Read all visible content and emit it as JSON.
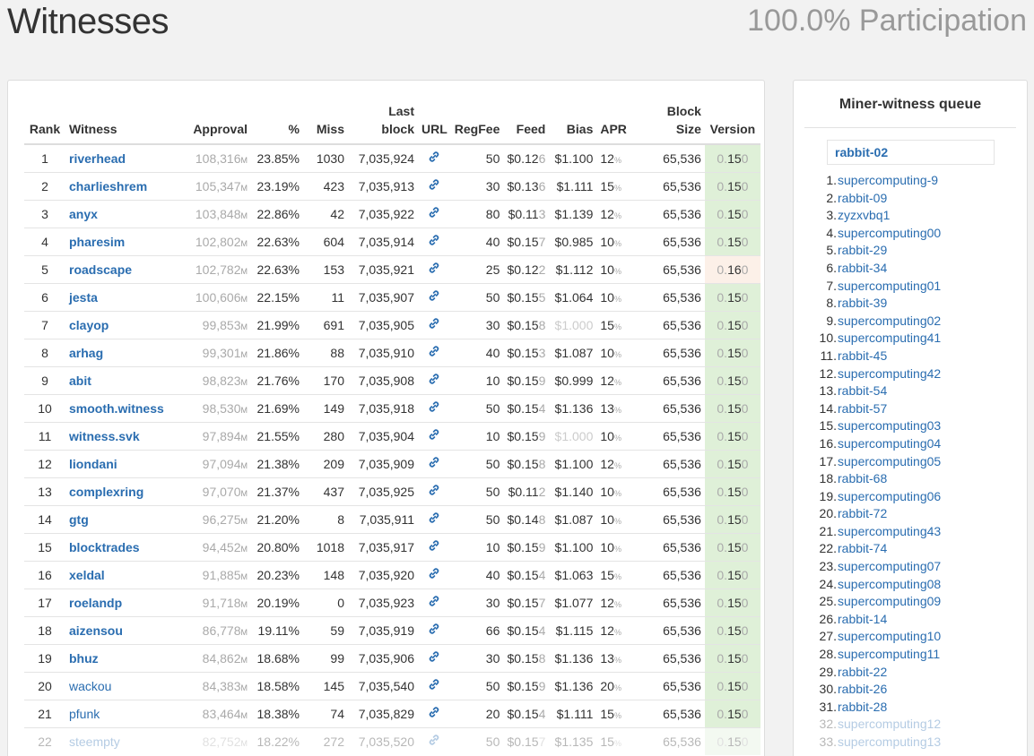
{
  "header": {
    "title": "Witnesses",
    "participation": "100.0% Participation"
  },
  "table": {
    "columns": {
      "rank": "Rank",
      "witness": "Witness",
      "approval": "Approval",
      "pct": "%",
      "miss": "Miss",
      "last1": "Last",
      "last2": "block",
      "url": "URL",
      "regfee": "RegFee",
      "feed": "Feed",
      "bias": "Bias",
      "apr": "APR",
      "size1": "Block",
      "size2": "Size",
      "version": "Version"
    },
    "approval_unit": "M",
    "apr_unit": "%",
    "version_prefix": "0.",
    "version_suffix": "0",
    "colors": {
      "link": "#2a6db0",
      "version_ok": "#dff0d8",
      "version_warn": "#fcf0e8"
    },
    "rows": [
      {
        "rank": "1",
        "name": "riverhead",
        "bold": true,
        "approval": "108,316",
        "pct": "23.85%",
        "miss": "1030",
        "last": "7,035,924",
        "regfee": "50",
        "feed_main": "$0.12",
        "feed_tail": "6",
        "bias": "$1.100",
        "bias_dim": false,
        "apr": "12",
        "size": "65,536",
        "version": "15",
        "ver_warn": false
      },
      {
        "rank": "2",
        "name": "charlieshrem",
        "bold": true,
        "approval": "105,347",
        "pct": "23.19%",
        "miss": "423",
        "last": "7,035,913",
        "regfee": "30",
        "feed_main": "$0.13",
        "feed_tail": "6",
        "bias": "$1.111",
        "bias_dim": false,
        "apr": "15",
        "size": "65,536",
        "version": "15",
        "ver_warn": false
      },
      {
        "rank": "3",
        "name": "anyx",
        "bold": true,
        "approval": "103,848",
        "pct": "22.86%",
        "miss": "42",
        "last": "7,035,922",
        "regfee": "80",
        "feed_main": "$0.11",
        "feed_tail": "3",
        "bias": "$1.139",
        "bias_dim": false,
        "apr": "12",
        "size": "65,536",
        "version": "15",
        "ver_warn": false
      },
      {
        "rank": "4",
        "name": "pharesim",
        "bold": true,
        "approval": "102,802",
        "pct": "22.63%",
        "miss": "604",
        "last": "7,035,914",
        "regfee": "40",
        "feed_main": "$0.15",
        "feed_tail": "7",
        "bias": "$0.985",
        "bias_dim": false,
        "apr": "10",
        "size": "65,536",
        "version": "15",
        "ver_warn": false
      },
      {
        "rank": "5",
        "name": "roadscape",
        "bold": true,
        "approval": "102,782",
        "pct": "22.63%",
        "miss": "153",
        "last": "7,035,921",
        "regfee": "25",
        "feed_main": "$0.12",
        "feed_tail": "2",
        "bias": "$1.112",
        "bias_dim": false,
        "apr": "10",
        "size": "65,536",
        "version": "16",
        "ver_warn": true
      },
      {
        "rank": "6",
        "name": "jesta",
        "bold": true,
        "approval": "100,606",
        "pct": "22.15%",
        "miss": "11",
        "last": "7,035,907",
        "regfee": "50",
        "feed_main": "$0.15",
        "feed_tail": "5",
        "bias": "$1.064",
        "bias_dim": false,
        "apr": "10",
        "size": "65,536",
        "version": "15",
        "ver_warn": false
      },
      {
        "rank": "7",
        "name": "clayop",
        "bold": true,
        "approval": "99,853",
        "pct": "21.99%",
        "miss": "691",
        "last": "7,035,905",
        "regfee": "30",
        "feed_main": "$0.15",
        "feed_tail": "8",
        "bias": "$1.000",
        "bias_dim": true,
        "apr": "15",
        "size": "65,536",
        "version": "15",
        "ver_warn": false
      },
      {
        "rank": "8",
        "name": "arhag",
        "bold": true,
        "approval": "99,301",
        "pct": "21.86%",
        "miss": "88",
        "last": "7,035,910",
        "regfee": "40",
        "feed_main": "$0.15",
        "feed_tail": "3",
        "bias": "$1.087",
        "bias_dim": false,
        "apr": "10",
        "size": "65,536",
        "version": "15",
        "ver_warn": false
      },
      {
        "rank": "9",
        "name": "abit",
        "bold": true,
        "approval": "98,823",
        "pct": "21.76%",
        "miss": "170",
        "last": "7,035,908",
        "regfee": "10",
        "feed_main": "$0.15",
        "feed_tail": "9",
        "bias": "$0.999",
        "bias_dim": false,
        "apr": "12",
        "size": "65,536",
        "version": "15",
        "ver_warn": false
      },
      {
        "rank": "10",
        "name": "smooth.witness",
        "bold": true,
        "approval": "98,530",
        "pct": "21.69%",
        "miss": "149",
        "last": "7,035,918",
        "regfee": "50",
        "feed_main": "$0.15",
        "feed_tail": "4",
        "bias": "$1.136",
        "bias_dim": false,
        "apr": "13",
        "size": "65,536",
        "version": "15",
        "ver_warn": false
      },
      {
        "rank": "11",
        "name": "witness.svk",
        "bold": true,
        "approval": "97,894",
        "pct": "21.55%",
        "miss": "280",
        "last": "7,035,904",
        "regfee": "10",
        "feed_main": "$0.15",
        "feed_tail": "9",
        "bias": "$1.000",
        "bias_dim": true,
        "apr": "10",
        "size": "65,536",
        "version": "15",
        "ver_warn": false
      },
      {
        "rank": "12",
        "name": "liondani",
        "bold": true,
        "approval": "97,094",
        "pct": "21.38%",
        "miss": "209",
        "last": "7,035,909",
        "regfee": "50",
        "feed_main": "$0.15",
        "feed_tail": "8",
        "bias": "$1.100",
        "bias_dim": false,
        "apr": "12",
        "size": "65,536",
        "version": "15",
        "ver_warn": false
      },
      {
        "rank": "13",
        "name": "complexring",
        "bold": true,
        "approval": "97,070",
        "pct": "21.37%",
        "miss": "437",
        "last": "7,035,925",
        "regfee": "50",
        "feed_main": "$0.11",
        "feed_tail": "2",
        "bias": "$1.140",
        "bias_dim": false,
        "apr": "10",
        "size": "65,536",
        "version": "15",
        "ver_warn": false
      },
      {
        "rank": "14",
        "name": "gtg",
        "bold": true,
        "approval": "96,275",
        "pct": "21.20%",
        "miss": "8",
        "last": "7,035,911",
        "regfee": "50",
        "feed_main": "$0.14",
        "feed_tail": "8",
        "bias": "$1.087",
        "bias_dim": false,
        "apr": "10",
        "size": "65,536",
        "version": "15",
        "ver_warn": false
      },
      {
        "rank": "15",
        "name": "blocktrades",
        "bold": true,
        "approval": "94,452",
        "pct": "20.80%",
        "miss": "1018",
        "last": "7,035,917",
        "regfee": "10",
        "feed_main": "$0.15",
        "feed_tail": "9",
        "bias": "$1.100",
        "bias_dim": false,
        "apr": "10",
        "size": "65,536",
        "version": "15",
        "ver_warn": false
      },
      {
        "rank": "16",
        "name": "xeldal",
        "bold": true,
        "approval": "91,885",
        "pct": "20.23%",
        "miss": "148",
        "last": "7,035,920",
        "regfee": "40",
        "feed_main": "$0.15",
        "feed_tail": "4",
        "bias": "$1.063",
        "bias_dim": false,
        "apr": "15",
        "size": "65,536",
        "version": "15",
        "ver_warn": false
      },
      {
        "rank": "17",
        "name": "roelandp",
        "bold": true,
        "approval": "91,718",
        "pct": "20.19%",
        "miss": "0",
        "last": "7,035,923",
        "regfee": "30",
        "feed_main": "$0.15",
        "feed_tail": "7",
        "bias": "$1.077",
        "bias_dim": false,
        "apr": "12",
        "size": "65,536",
        "version": "15",
        "ver_warn": false
      },
      {
        "rank": "18",
        "name": "aizensou",
        "bold": true,
        "approval": "86,778",
        "pct": "19.11%",
        "miss": "59",
        "last": "7,035,919",
        "regfee": "66",
        "feed_main": "$0.15",
        "feed_tail": "4",
        "bias": "$1.115",
        "bias_dim": false,
        "apr": "12",
        "size": "65,536",
        "version": "15",
        "ver_warn": false
      },
      {
        "rank": "19",
        "name": "bhuz",
        "bold": true,
        "approval": "84,862",
        "pct": "18.68%",
        "miss": "99",
        "last": "7,035,906",
        "regfee": "30",
        "feed_main": "$0.15",
        "feed_tail": "8",
        "bias": "$1.136",
        "bias_dim": false,
        "apr": "13",
        "size": "65,536",
        "version": "15",
        "ver_warn": false
      },
      {
        "rank": "20",
        "name": "wackou",
        "bold": false,
        "approval": "84,383",
        "pct": "18.58%",
        "miss": "145",
        "last": "7,035,540",
        "regfee": "50",
        "feed_main": "$0.15",
        "feed_tail": "9",
        "bias": "$1.136",
        "bias_dim": false,
        "apr": "20",
        "size": "65,536",
        "version": "15",
        "ver_warn": false
      },
      {
        "rank": "21",
        "name": "pfunk",
        "bold": false,
        "approval": "83,464",
        "pct": "18.38%",
        "miss": "74",
        "last": "7,035,829",
        "regfee": "20",
        "feed_main": "$0.15",
        "feed_tail": "4",
        "bias": "$1.111",
        "bias_dim": false,
        "apr": "15",
        "size": "65,536",
        "version": "15",
        "ver_warn": false
      },
      {
        "rank": "22",
        "name": "steempty",
        "bold": false,
        "approval": "82,752",
        "pct": "18.22%",
        "miss": "272",
        "last": "7,035,520",
        "regfee": "50",
        "feed_main": "$0.15",
        "feed_tail": "7",
        "bias": "$1.135",
        "bias_dim": false,
        "apr": "15",
        "size": "65,536",
        "version": "15",
        "ver_warn": false,
        "fade": true
      }
    ]
  },
  "queue": {
    "title": "Miner-witness queue",
    "current": "rabbit-02",
    "items": [
      "supercomputing-9",
      "rabbit-09",
      "zyzxvbq1",
      "supercomputing00",
      "rabbit-29",
      "rabbit-34",
      "supercomputing01",
      "rabbit-39",
      "supercomputing02",
      "supercomputing41",
      "rabbit-45",
      "supercomputing42",
      "rabbit-54",
      "rabbit-57",
      "supercomputing03",
      "supercomputing04",
      "supercomputing05",
      "rabbit-68",
      "supercomputing06",
      "rabbit-72",
      "supercomputing43",
      "rabbit-74",
      "supercomputing07",
      "supercomputing08",
      "supercomputing09",
      "rabbit-14",
      "supercomputing10",
      "supercomputing11",
      "rabbit-22",
      "rabbit-26",
      "rabbit-28",
      "supercomputing12",
      "supercomputing13"
    ]
  }
}
